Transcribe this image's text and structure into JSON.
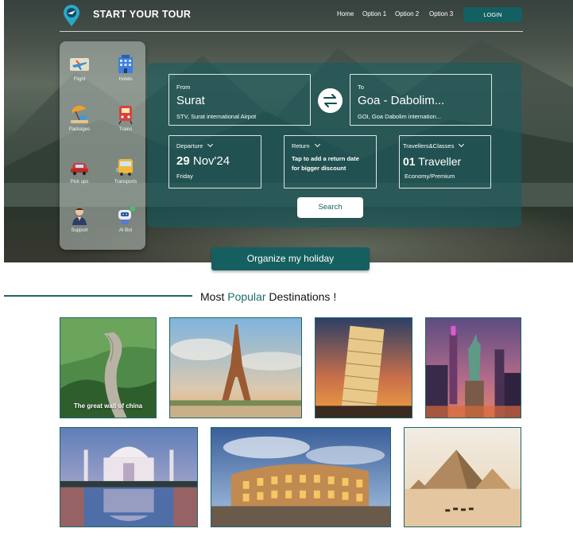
{
  "header": {
    "brand": "START YOUR TOUR",
    "nav": [
      "Home",
      "Option 1",
      "Option 2",
      "Option 3"
    ],
    "login": "LOGIN"
  },
  "services": [
    {
      "label": "Flight",
      "icon": "plane-icon"
    },
    {
      "label": "Hotels",
      "icon": "hotel-icon"
    },
    {
      "label": "Packages",
      "icon": "beach-umbrella-icon"
    },
    {
      "label": "Trains",
      "icon": "train-icon"
    },
    {
      "label": "Pick ups",
      "icon": "car-icon"
    },
    {
      "label": "Transports",
      "icon": "bus-icon"
    },
    {
      "label": "Support",
      "icon": "support-agent-icon"
    },
    {
      "label": "AI Bot",
      "icon": "robot-icon"
    }
  ],
  "booking": {
    "from": {
      "label": "From",
      "city": "Surat",
      "airport": "STV, Surat international Airpot"
    },
    "to": {
      "label": "To",
      "city": "Goa - Dabolim...",
      "airport": "GOI, Goa Dabolim internation..."
    },
    "departure": {
      "label": "Departure",
      "day": "29",
      "month": "Nov'24",
      "weekday": "Friday"
    },
    "return": {
      "label": "Return",
      "hint": "Tap to add a return date for bigger discount"
    },
    "travellers": {
      "label": "Travellers&Classes",
      "count": "01",
      "unit": "Traveller",
      "class": "Economy/Premium"
    },
    "search": "Search"
  },
  "organize": "Organize my holiday",
  "destinations": {
    "heading_pre": "Most",
    "heading_hl": "Popular",
    "heading_post": "Destinations !",
    "cards": [
      {
        "caption": "The great wall of china",
        "icon": "great-wall-photo"
      },
      {
        "caption": "",
        "icon": "eiffel-tower-photo"
      },
      {
        "caption": "",
        "icon": "leaning-tower-pisa-photo"
      },
      {
        "caption": "",
        "icon": "statue-of-liberty-photo"
      },
      {
        "caption": "",
        "icon": "taj-mahal-photo"
      },
      {
        "caption": "",
        "icon": "colosseum-photo"
      },
      {
        "caption": "",
        "icon": "pyramids-photo"
      }
    ]
  },
  "colors": {
    "accent": "#155f61",
    "panel": "#185c60",
    "highlight": "#1d6b6e"
  }
}
